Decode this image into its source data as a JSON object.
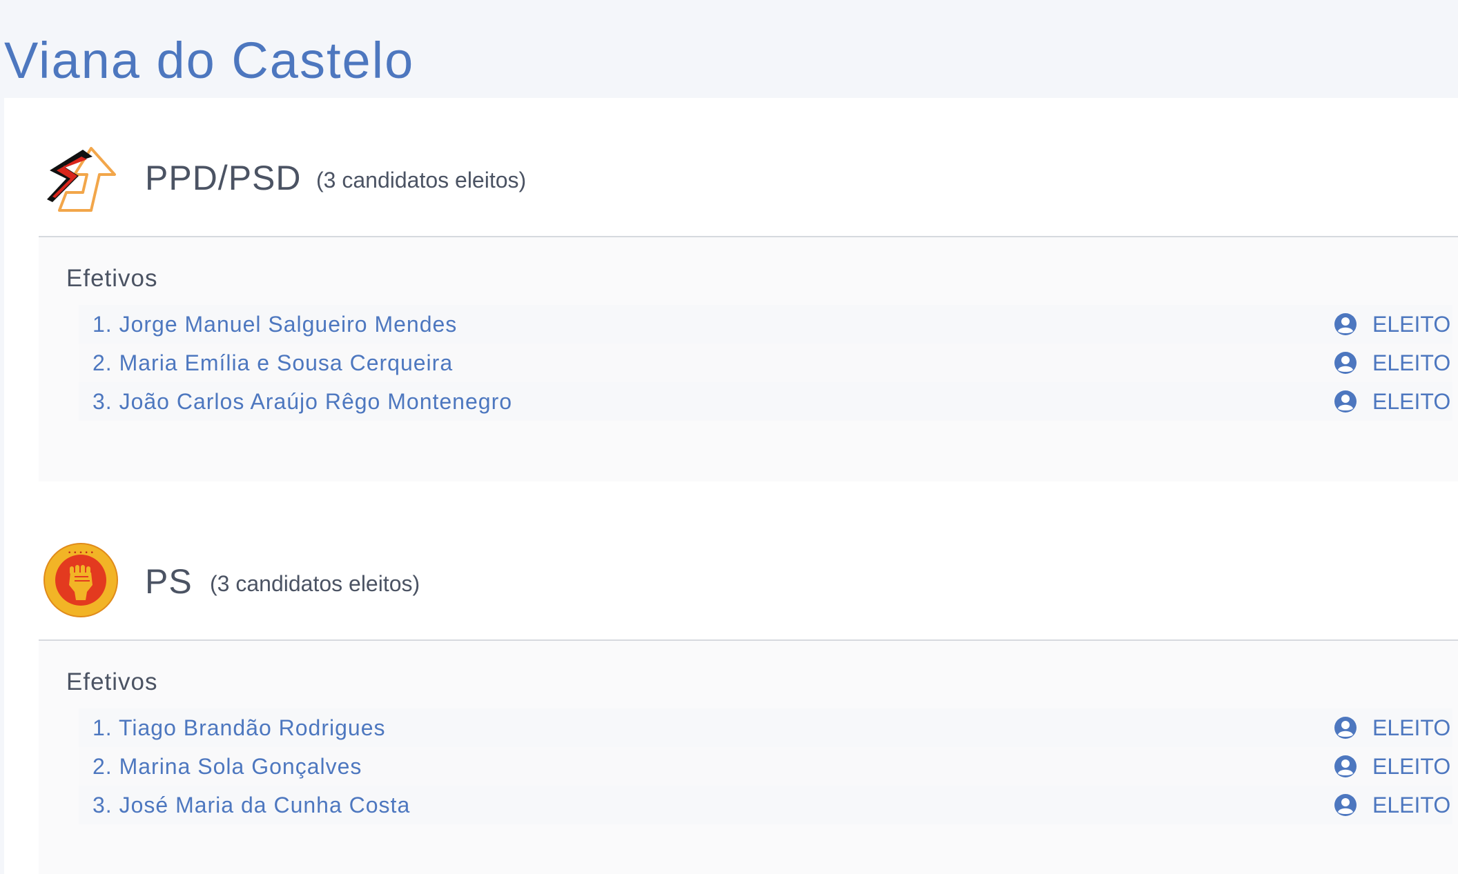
{
  "district": {
    "title": "Viana do Castelo"
  },
  "colors": {
    "accent": "#4d77bf",
    "text": "#4b5363"
  },
  "parties": [
    {
      "name": "PPD/PSD",
      "count_label": "(3 candidatos eleitos)",
      "logo_icon": "psd-arrow-logo-icon",
      "section_label": "Efetivos",
      "candidates": [
        {
          "name": "1. Jorge Manuel Salgueiro Mendes",
          "status": "ELEITO"
        },
        {
          "name": "2. Maria Emília e Sousa Cerqueira",
          "status": "ELEITO"
        },
        {
          "name": "3. João Carlos Araújo Rêgo Montenegro",
          "status": "ELEITO"
        }
      ]
    },
    {
      "name": "PS",
      "count_label": "(3 candidatos eleitos)",
      "logo_icon": "ps-fist-logo-icon",
      "section_label": "Efetivos",
      "candidates": [
        {
          "name": "1. Tiago Brandão Rodrigues",
          "status": "ELEITO"
        },
        {
          "name": "2. Marina Sola Gonçalves",
          "status": "ELEITO"
        },
        {
          "name": "3. José Maria da Cunha Costa",
          "status": "ELEITO"
        }
      ]
    }
  ]
}
